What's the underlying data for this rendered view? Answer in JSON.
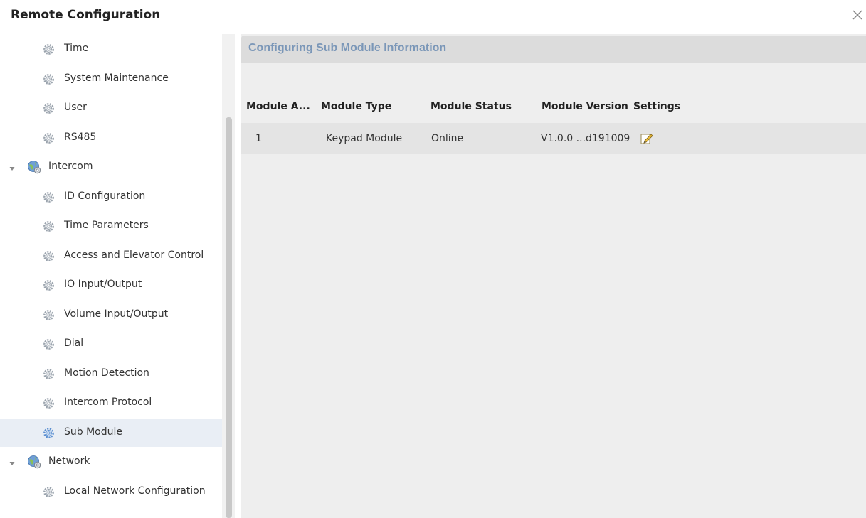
{
  "window": {
    "title": "Remote Configuration",
    "close_icon": "close-icon"
  },
  "sidebar": {
    "items": [
      {
        "label": "Time",
        "type": "leaf",
        "icon": "gear-icon"
      },
      {
        "label": "System Maintenance",
        "type": "leaf",
        "icon": "gear-icon"
      },
      {
        "label": "User",
        "type": "leaf",
        "icon": "gear-icon"
      },
      {
        "label": "RS485",
        "type": "leaf",
        "icon": "gear-icon"
      },
      {
        "label": "Intercom",
        "type": "group",
        "icon": "globe-gear-icon",
        "expanded": true
      },
      {
        "label": "ID Configuration",
        "type": "leaf",
        "icon": "gear-icon"
      },
      {
        "label": "Time Parameters",
        "type": "leaf",
        "icon": "gear-icon"
      },
      {
        "label": "Access and Elevator Control",
        "type": "leaf",
        "icon": "gear-icon"
      },
      {
        "label": "IO Input/Output",
        "type": "leaf",
        "icon": "gear-icon"
      },
      {
        "label": "Volume Input/Output",
        "type": "leaf",
        "icon": "gear-icon"
      },
      {
        "label": "Dial",
        "type": "leaf",
        "icon": "gear-icon"
      },
      {
        "label": "Motion Detection",
        "type": "leaf",
        "icon": "gear-icon"
      },
      {
        "label": "Intercom Protocol",
        "type": "leaf",
        "icon": "gear-icon"
      },
      {
        "label": "Sub Module",
        "type": "leaf",
        "icon": "gear-icon",
        "selected": true
      },
      {
        "label": "Network",
        "type": "group",
        "icon": "globe-gear-icon",
        "expanded": true
      },
      {
        "label": "Local Network Configuration",
        "type": "leaf",
        "icon": "gear-icon"
      }
    ]
  },
  "panel": {
    "title": "Configuring Sub Module Information",
    "columns": [
      "Module A...",
      "Module Type",
      "Module Status",
      "Module Version",
      "Settings"
    ],
    "rows": [
      {
        "address": "1",
        "type": "Keypad Module",
        "status": "Online",
        "version": "V1.0.0 ...d191009",
        "settings_icon": "edit-icon"
      }
    ]
  },
  "colors": {
    "panel_title": "#7b97b8",
    "panel_header_bg": "#dcdcdc",
    "content_bg": "#eeeeee",
    "row_bg": "#e4e4e4",
    "selected_bg": "#e9eef5"
  }
}
